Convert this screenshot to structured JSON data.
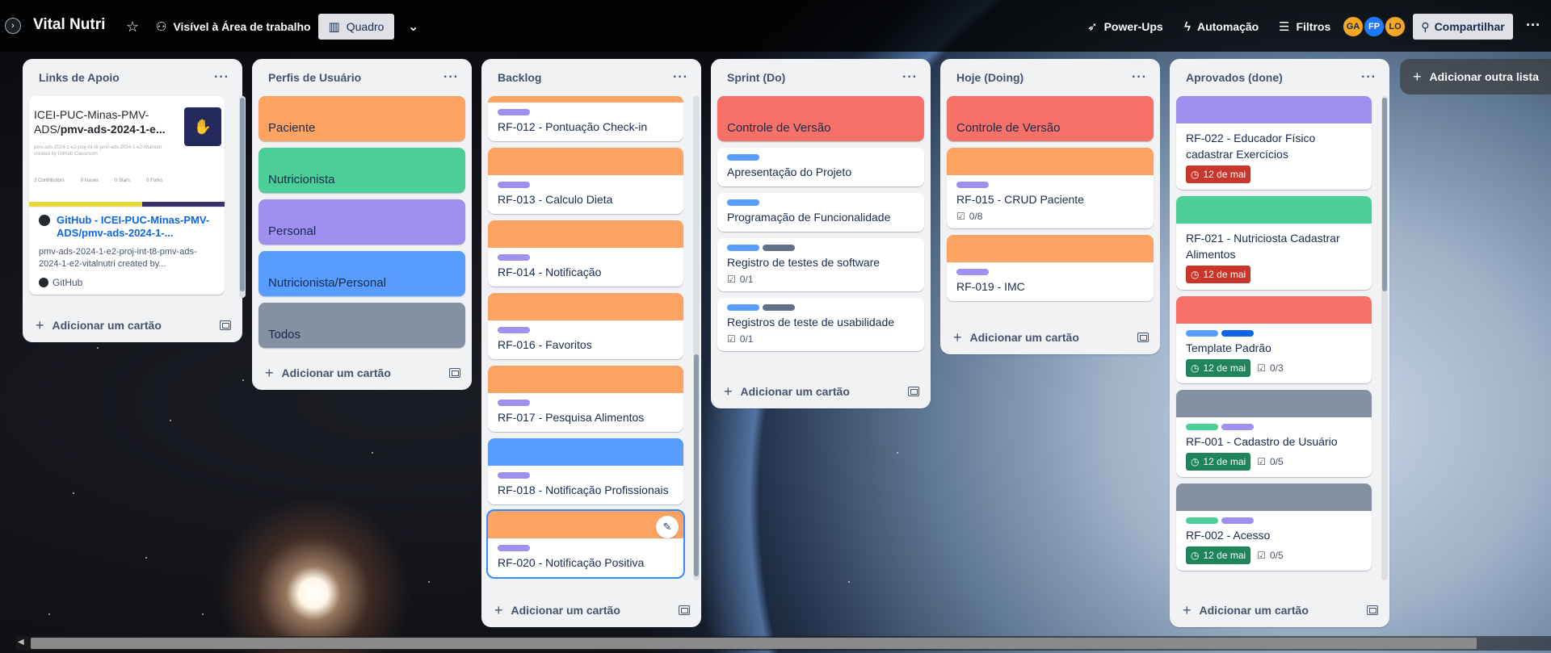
{
  "header": {
    "board_title": "Vital Nutri",
    "visibility": "Visível à Área de trabalho",
    "view": "Quadro",
    "powerups": "Power-Ups",
    "automation": "Automação",
    "filters": "Filtros",
    "avatars": [
      {
        "initials": "GA",
        "color": "#f5a623"
      },
      {
        "initials": "FP",
        "color": "#1d7afc"
      },
      {
        "initials": "LO",
        "color": "#f5a623"
      }
    ],
    "share": "Compartilhar"
  },
  "common": {
    "add_card": "Adicionar um cartão",
    "add_list": "Adicionar outra lista"
  },
  "colors": {
    "orange": "#fea362",
    "green": "#4bce97",
    "purple": "#9f8fef",
    "blue": "#579dff",
    "gray": "#8590a2",
    "red": "#f87168",
    "dark_blue": "#0c66e4",
    "due_red": "#c9372c",
    "due_green": "#1f845a"
  },
  "lists": [
    {
      "title": "Links de Apoio",
      "link_card": {
        "preview_title_plain": "ICEI-PUC-Minas-PMV-ADS/",
        "preview_title_bold": "pmv-ads-2024-1-e...",
        "preview_sub": "pmv-ads-2024-1-e2-proj-int-t8-pmv-ads-2024-1-e2-vitalnutri created by GitHub Classroom",
        "preview_stats": [
          "3 Contributors",
          "0 Issues",
          "0 Stars",
          "0 Forks"
        ],
        "title": "GitHub - ICEI-PUC-Minas-PMV-ADS/pmv-ads-2024-1-...",
        "description": "pmv-ads-2024-1-e2-proj-int-t8-pmv-ads-2024-1-e2-vitalnutri created by...",
        "source": "GitHub"
      }
    },
    {
      "title": "Perfis de Usuário",
      "cards": [
        {
          "title": "Paciente",
          "color": "#fea362"
        },
        {
          "title": "Nutricionista",
          "color": "#4bce97"
        },
        {
          "title": "Personal",
          "color": "#9f8fef"
        },
        {
          "title": "Nutricionista/Personal",
          "color": "#579dff"
        },
        {
          "title": "Todos",
          "color": "#8590a2"
        }
      ]
    },
    {
      "title": "Backlog",
      "cards": [
        {
          "title": "RF-012 - Pontuação Check-in"
        },
        {
          "title": "RF-013 - Calculo Dieta"
        },
        {
          "title": "RF-014 - Notificação"
        },
        {
          "title": "RF-016 - Favoritos"
        },
        {
          "title": "RF-017 - Pesquisa Alimentos"
        },
        {
          "title": "RF-018 - Notificação Profissionais"
        },
        {
          "title": "RF-020 - Notificação Positiva"
        }
      ]
    },
    {
      "title": "Sprint (Do)",
      "cards": [
        {
          "title": "Controle de Versão"
        },
        {
          "title": "Apresentação do Projeto"
        },
        {
          "title": "Programação de Funcionalidade"
        },
        {
          "title": "Registro de testes de software",
          "checklist": "0/1"
        },
        {
          "title": "Registros de teste de usabilidade",
          "checklist": "0/1"
        }
      ]
    },
    {
      "title": "Hoje (Doing)",
      "cards": [
        {
          "title": "Controle de Versão"
        },
        {
          "title": "RF-015 - CRUD Paciente",
          "checklist": "0/8"
        },
        {
          "title": "RF-019 - IMC"
        }
      ]
    },
    {
      "title": "Aprovados (done)",
      "cards": [
        {
          "title": "RF-022 - Educador Físico cadastrar Exercícios",
          "due": "12 de mai"
        },
        {
          "title": "RF-021 - Nutriciosta Cadastrar Alimentos",
          "due": "12 de mai"
        },
        {
          "title": "Template Padrão",
          "due": "12 de mai",
          "checklist": "0/3"
        },
        {
          "title": "RF-001 - Cadastro de Usuário",
          "due": "12 de mai",
          "checklist": "0/5"
        },
        {
          "title": "RF-002 - Acesso",
          "due": "12 de mai",
          "checklist": "0/5"
        }
      ]
    }
  ]
}
